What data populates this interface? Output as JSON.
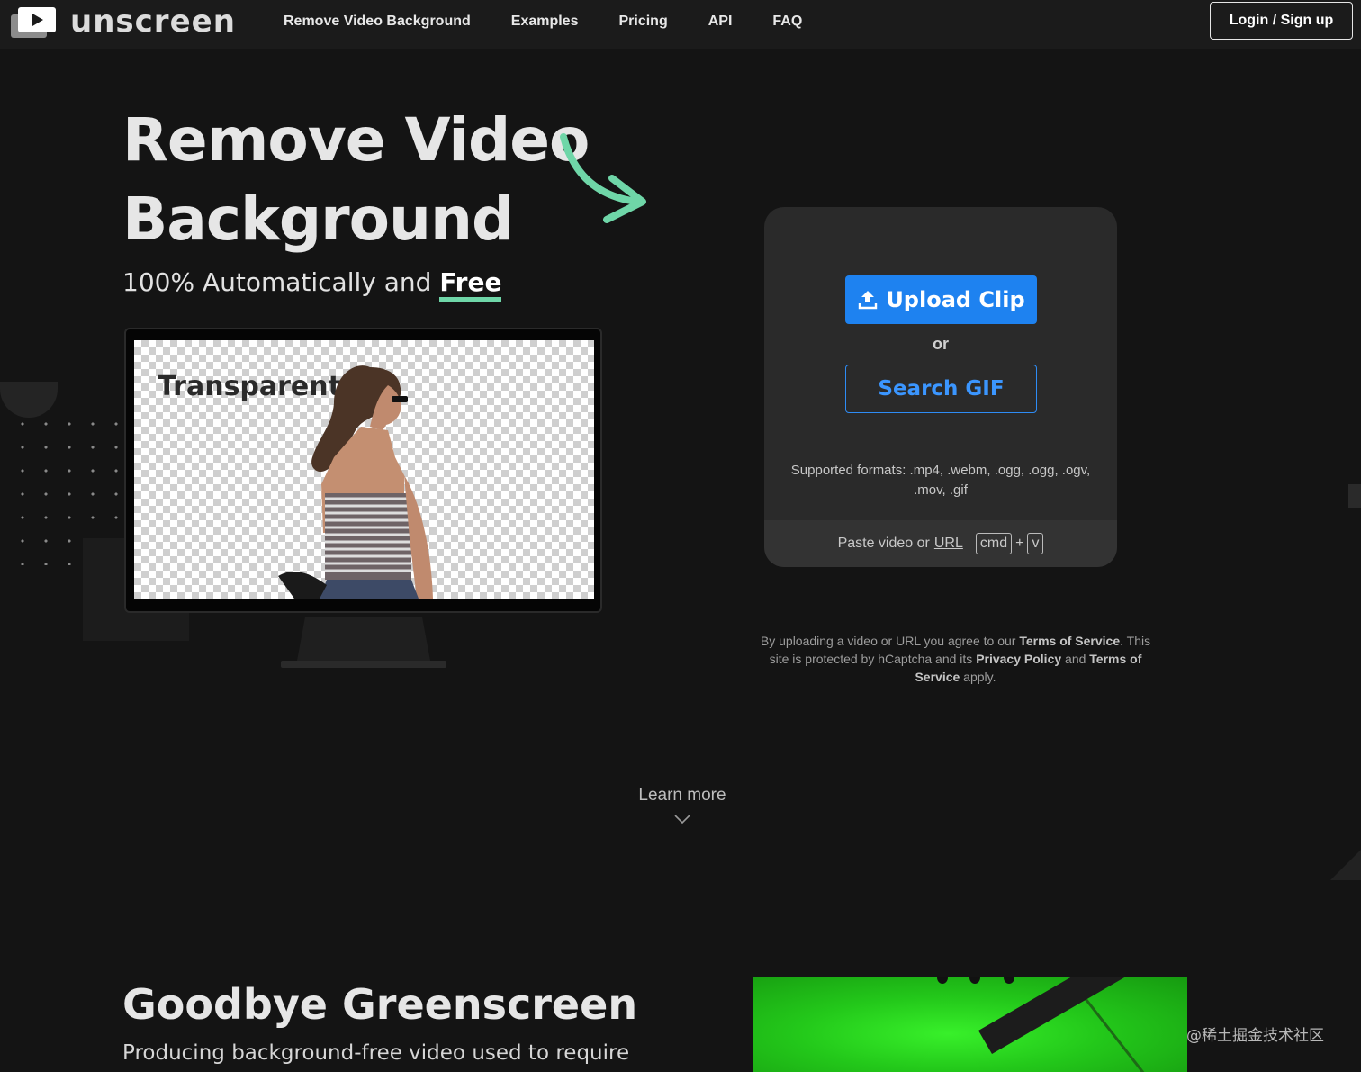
{
  "brand": {
    "name": "unscreen"
  },
  "nav": {
    "items": [
      {
        "label": "Remove Video Background"
      },
      {
        "label": "Examples"
      },
      {
        "label": "Pricing"
      },
      {
        "label": "API"
      },
      {
        "label": "FAQ"
      }
    ],
    "login_label": "Login / Sign up"
  },
  "hero": {
    "title": "Remove Video Background",
    "subtitle_prefix": "100% Automatically and ",
    "subtitle_highlight": "Free",
    "preview_label": "Transparent"
  },
  "upload": {
    "upload_label": "Upload Clip",
    "or_label": "or",
    "search_label": "Search GIF",
    "formats": "Supported formats: .mp4, .webm, .ogg, .ogg, .ogv, .mov, .gif",
    "paste_prefix": "Paste video or",
    "paste_url": "URL",
    "key_cmd": "cmd",
    "key_plus": "+",
    "key_v": "v"
  },
  "terms": {
    "t1": "By uploading a video or URL you agree to our ",
    "tos": "Terms of Service",
    "t2": ". This site is protected by hCaptcha and its ",
    "privacy": "Privacy Policy",
    "t3": " and ",
    "tos2": "Terms of Service",
    "t4": " apply."
  },
  "learn_more": "Learn more",
  "section": {
    "title": "Goodbye Greenscreen",
    "text": "Producing background-free video used to require"
  },
  "watermark": "@稀土掘金技术社区",
  "colors": {
    "accent_blue": "#1e82f0",
    "accent_green": "#6fd6a8",
    "background": "#141414",
    "card": "#2a2a2a"
  }
}
